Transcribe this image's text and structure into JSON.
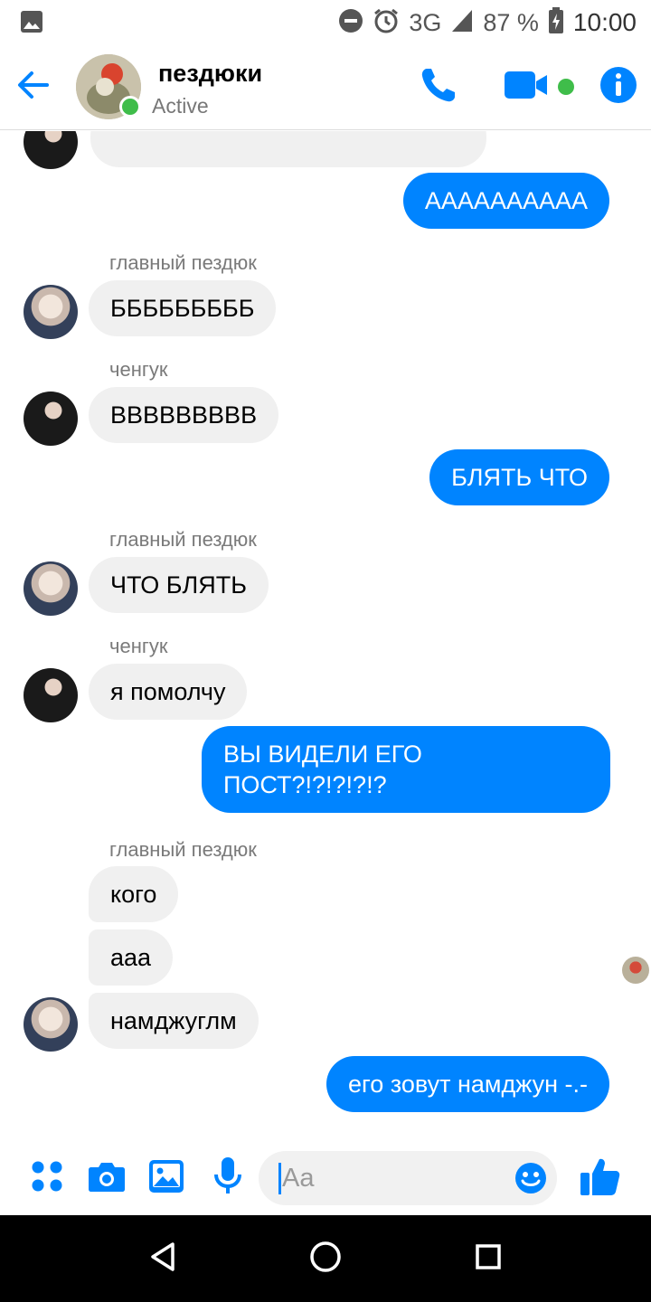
{
  "status_bar": {
    "network": "3G",
    "battery": "87 %",
    "time": "10:00"
  },
  "header": {
    "title": "пездюки",
    "status": "Active"
  },
  "messages": [
    {
      "dir": "out",
      "text": "АААААААААА"
    },
    {
      "dir": "in",
      "sender": "главный пездюк",
      "text": "БББББББББ"
    },
    {
      "dir": "in",
      "sender": "ченгук",
      "text": "ВВВВВВВВВ"
    },
    {
      "dir": "out",
      "text": "БЛЯТЬ ЧТО"
    },
    {
      "dir": "in",
      "sender": "главный пездюк",
      "text": "ЧТО БЛЯТЬ"
    },
    {
      "dir": "in",
      "sender": "ченгук",
      "text": "я помолчу"
    },
    {
      "dir": "out",
      "text": "ВЫ ВИДЕЛИ ЕГО ПОСТ?!?!?!?!?"
    },
    {
      "dir": "in",
      "sender": "главный пездюк",
      "text": "кого"
    },
    {
      "dir": "in",
      "text": "ааа"
    },
    {
      "dir": "in",
      "text": "намджуглм"
    },
    {
      "dir": "out",
      "text": "его зовут намджун -.-"
    }
  ],
  "composer": {
    "placeholder": "Aa"
  },
  "icons": {
    "status_left": "image-notification-icon",
    "do_not_disturb": "do-not-disturb-icon",
    "alarm": "alarm-icon",
    "signal": "signal-icon",
    "battery": "battery-charging-icon",
    "back": "back-arrow-icon",
    "call": "phone-icon",
    "video": "video-camera-icon",
    "info": "info-icon",
    "more": "more-apps-icon",
    "camera": "camera-icon",
    "gallery": "gallery-icon",
    "mic": "microphone-icon",
    "emoji": "emoji-icon",
    "like": "thumbs-up-icon"
  },
  "colors": {
    "accent": "#0084ff",
    "incoming_bubble": "#f0f0f0",
    "online": "#3fbd4a"
  }
}
